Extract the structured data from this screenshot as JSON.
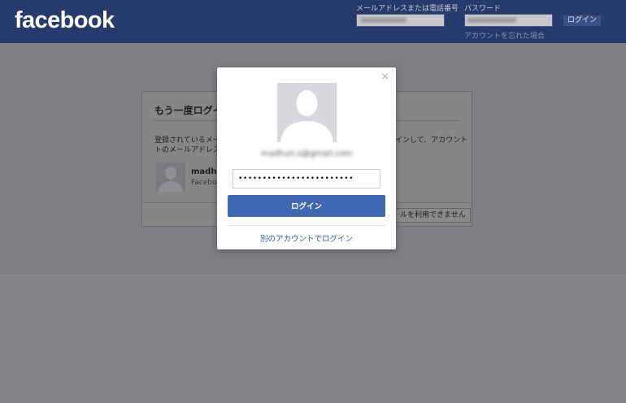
{
  "header": {
    "logo": "facebook",
    "email_label": "メールアドレスまたは電話番号",
    "email_value": "(▪▪▪▪▪▪▪▪▪▪",
    "password_label": "パスワード",
    "password_value": "▪▪▪▪▪▪▪▪▪▪▪",
    "login_label": "ログイン",
    "forgot_link": "アカウントを忘れた場合"
  },
  "background_card": {
    "title": "もう一度ログイ",
    "text_line1": "登録されているメー",
    "text_line1_end": "インして、アカウント",
    "text_line2": "トのメールアドレス",
    "account_name": "madha",
    "account_sub": "Faceboo",
    "footer_button": "ルを利用できません"
  },
  "modal": {
    "close": "×",
    "email": "madhuri.s@gmail.com",
    "password_mask": "••••••••••••••••••••••••",
    "login_label": "ログイン",
    "other_account_link": "別のアカウントでログイン"
  },
  "colors": {
    "header_bg": "#253b6e",
    "button_blue": "#4267b2",
    "link_blue": "#365899"
  }
}
